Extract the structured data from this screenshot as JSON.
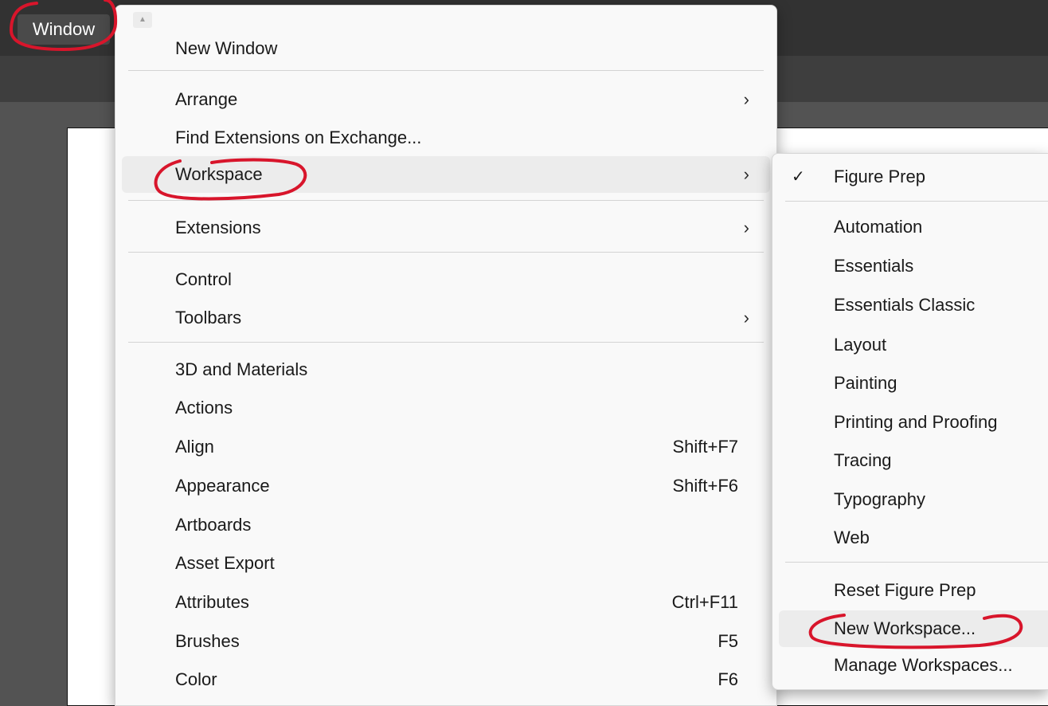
{
  "menubar": {
    "active_menu": "Window"
  },
  "menu": {
    "scroll_up_icon": "caret-up-icon",
    "items": [
      {
        "label": "New Window"
      },
      {
        "label": "Arrange",
        "arrow": "›"
      },
      {
        "label": "Find Extensions on Exchange..."
      },
      {
        "label": "Workspace",
        "arrow": "›"
      },
      {
        "label": "Extensions",
        "arrow": "›"
      },
      {
        "label": "Control"
      },
      {
        "label": "Toolbars",
        "arrow": "›"
      },
      {
        "label": "3D and Materials"
      },
      {
        "label": "Actions"
      },
      {
        "label": "Align",
        "shortcut": "Shift+F7"
      },
      {
        "label": "Appearance",
        "shortcut": "Shift+F6"
      },
      {
        "label": "Artboards"
      },
      {
        "label": "Asset Export"
      },
      {
        "label": "Attributes",
        "shortcut": "Ctrl+F11"
      },
      {
        "label": "Brushes",
        "shortcut": "F5"
      },
      {
        "label": "Color",
        "shortcut": "F6"
      }
    ]
  },
  "workspace_submenu": {
    "check_mark": "✓",
    "items": [
      {
        "label": "Figure Prep"
      },
      {
        "label": "Automation"
      },
      {
        "label": "Essentials"
      },
      {
        "label": "Essentials Classic"
      },
      {
        "label": "Layout"
      },
      {
        "label": "Painting"
      },
      {
        "label": "Printing and Proofing"
      },
      {
        "label": "Tracing"
      },
      {
        "label": "Typography"
      },
      {
        "label": "Web"
      },
      {
        "label": "Reset Figure Prep"
      },
      {
        "label": "New Workspace..."
      },
      {
        "label": "Manage Workspaces..."
      }
    ]
  },
  "colors": {
    "annotation": "#d8152b",
    "menu_background": "#f9f9f9",
    "menubar": "#323232",
    "workspace_area": "#535353"
  }
}
